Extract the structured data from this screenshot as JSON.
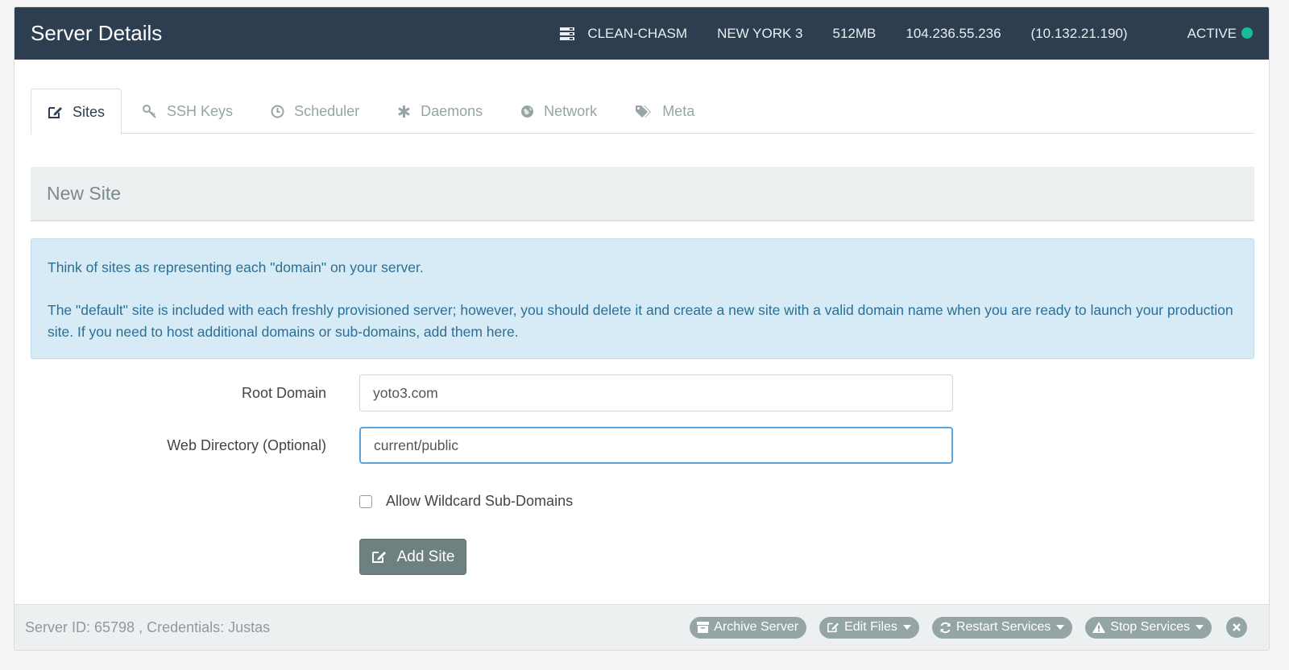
{
  "header": {
    "title": "Server Details",
    "server_icon": "server-icon",
    "server_name": "CLEAN-CHASM",
    "region": "NEW YORK 3",
    "memory": "512MB",
    "public_ip": "104.236.55.236",
    "private_ip": "(10.132.21.190)",
    "status": "ACTIVE",
    "status_color": "#18bc9c"
  },
  "tabs": [
    {
      "label": "Sites",
      "icon": "edit-icon",
      "active": true
    },
    {
      "label": "SSH Keys",
      "icon": "key-icon"
    },
    {
      "label": "Scheduler",
      "icon": "clock-icon"
    },
    {
      "label": "Daemons",
      "icon": "asterisk-icon"
    },
    {
      "label": "Network",
      "icon": "globe-icon"
    },
    {
      "label": "Meta",
      "icon": "tags-icon"
    }
  ],
  "section": {
    "title": "New Site"
  },
  "info": {
    "line1": "Think of sites as representing each \"domain\" on your server.",
    "line2": "The \"default\" site is included with each freshly provisioned server; however, you should delete it and create a new site with a valid domain name when you are ready to launch your production site. If you need to host additional domains or sub-domains, add them here."
  },
  "form": {
    "root_domain_label": "Root Domain",
    "root_domain_value": "yoto3.com",
    "web_dir_label": "Web Directory (Optional)",
    "web_dir_value": "current/public",
    "wildcard_label": "Allow Wildcard Sub-Domains",
    "wildcard_checked": false,
    "submit_label": "Add Site"
  },
  "footer": {
    "server_info": "Server ID: 65798 , Credentials: Justas",
    "archive_label": "Archive Server",
    "edit_files_label": "Edit Files",
    "restart_label": "Restart Services",
    "stop_label": "Stop Services"
  },
  "colors": {
    "header_bg": "#2c3e50",
    "accent_button": "#6f8080",
    "info_bg": "#d6ebf5",
    "pill_bg": "#95a5a6"
  }
}
